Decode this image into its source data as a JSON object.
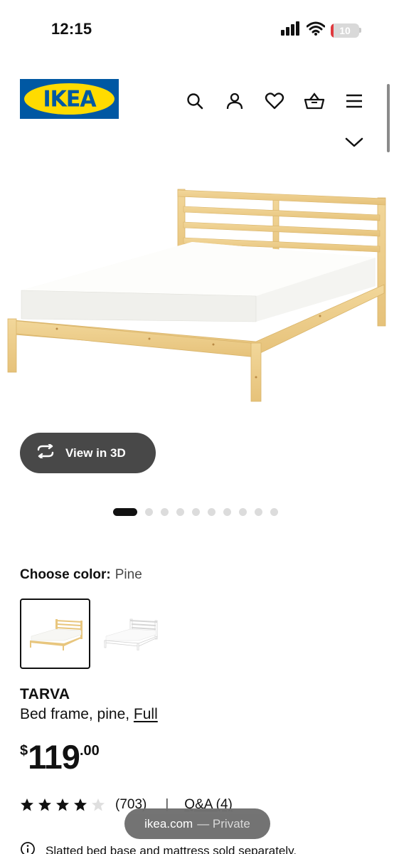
{
  "status_bar": {
    "time": "12:15",
    "battery": {
      "level_text": "10",
      "level_percent": 10,
      "color": "#e0393e"
    },
    "icons": [
      "cellular-signal-icon",
      "wifi-icon",
      "battery-icon"
    ]
  },
  "header": {
    "logo_text": "IKEA",
    "logo_registered": "®",
    "brand_colors": {
      "blue": "#0058a3",
      "yellow": "#ffdb00"
    },
    "nav_icons": [
      "search-icon",
      "user-icon",
      "heart-icon",
      "basket-icon",
      "menu-icon"
    ],
    "expand_icon": "chevron-down-icon"
  },
  "gallery": {
    "view_3d_label": "View in 3D",
    "view_3d_icon": "rotate-icon",
    "image_count": 10,
    "active_index": 0
  },
  "product": {
    "choose_color_label": "Choose color:",
    "color_value": "Pine",
    "swatches": [
      {
        "name": "Pine",
        "selected": true
      },
      {
        "name": "White",
        "selected": false
      }
    ],
    "name": "TARVA",
    "description": "Bed frame, pine, ",
    "size_link": "Full",
    "price": {
      "currency": "$",
      "integer": "119",
      "decimal": ".00"
    },
    "rating": {
      "stars": 4,
      "max_stars": 5,
      "review_count": "(703)"
    },
    "separator": "|",
    "qa_label": "Q&A (4)",
    "notice": "Slatted bed base and mattress sold separately."
  },
  "browser": {
    "domain": "ikea.com",
    "mode": "— Private"
  }
}
